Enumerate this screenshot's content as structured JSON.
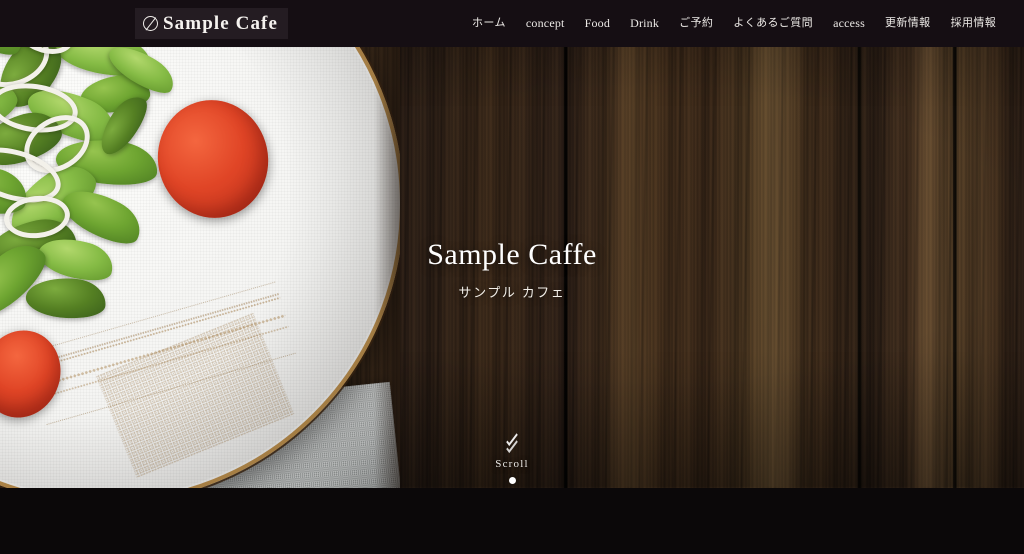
{
  "site": {
    "title": "Sample Cafe"
  },
  "header": {
    "logo": {
      "icon": "circle-slash-icon",
      "text": "Sample Cafe"
    },
    "nav_items": [
      {
        "label": "ホーム",
        "lang": "jp"
      },
      {
        "label": "concept",
        "lang": "en"
      },
      {
        "label": "Food",
        "lang": "en"
      },
      {
        "label": "Drink",
        "lang": "en"
      },
      {
        "label": "ご予約",
        "lang": "jp"
      },
      {
        "label": "よくあるご質問",
        "lang": "jp"
      },
      {
        "label": "access",
        "lang": "en"
      },
      {
        "label": "更新情報",
        "lang": "jp"
      },
      {
        "label": "採用情報",
        "lang": "jp"
      }
    ]
  },
  "hero": {
    "title": "Sample Caffe",
    "subtitle": "サンプル カフェ",
    "scroll_label": "Scroll",
    "scroll_icon": "chevron-double-down-icon",
    "slider": {
      "total_dots": 1,
      "active_index": 0
    },
    "background_description": "Salad plate on dark wood table"
  },
  "colors": {
    "header_bg": "#150e13",
    "logo_box_bg": "#241c22",
    "text_light": "#f5f2ef",
    "wood_dark": "#2e2017",
    "wood_light": "#553f27",
    "plate_white": "#f4f4f2",
    "plate_rim_gold": "#b98d4c",
    "page_bg": "#0b0809"
  }
}
